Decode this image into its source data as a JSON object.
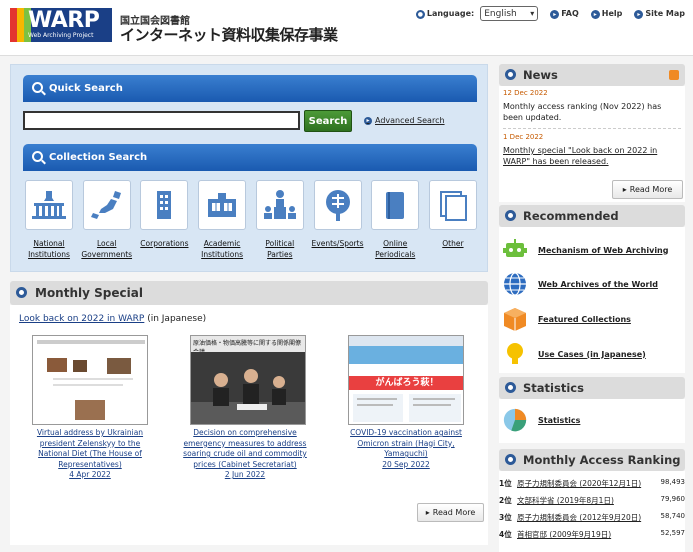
{
  "header": {
    "logo_text": "WARP",
    "logo_subtitle": "Web Archiving Project",
    "org_name": "国立国会図書館",
    "site_title": "インターネット資料収集保存事業",
    "language_label": "Language:",
    "language_value": "English",
    "faq_label": "FAQ",
    "help_label": "Help",
    "sitemap_label": "Site Map"
  },
  "quick_search": {
    "title": "Quick Search",
    "input_value": "",
    "button_label": "Search",
    "advanced_label": "Advanced Search"
  },
  "collection_search": {
    "title": "Collection Search",
    "items": [
      {
        "label": "National Institutions",
        "icon": "diet-building-icon"
      },
      {
        "label": "Local Governments",
        "icon": "japan-map-icon"
      },
      {
        "label": "Corporations",
        "icon": "office-building-icon"
      },
      {
        "label": "Academic Institutions",
        "icon": "school-icon"
      },
      {
        "label": "Political Parties",
        "icon": "politician-podium-icon"
      },
      {
        "label": "Events/Sports",
        "icon": "festival-fan-icon"
      },
      {
        "label": "Online Periodicals",
        "icon": "book-icon"
      },
      {
        "label": "Other",
        "icon": "documents-icon"
      }
    ]
  },
  "monthly_special": {
    "title": "Monthly Special",
    "intro_link": "Look back on 2022 in WARP",
    "intro_suffix": " (in Japanese)",
    "items": [
      {
        "caption": "Virtual address by Ukrainian president Zelenskyy to the National Diet (The House of Representatives)",
        "date": "4 Apr 2022"
      },
      {
        "caption": "Decision on comprehensive emergency measures to address soaring crude oil and commodity prices (Cabinet Secretariat)",
        "date": "2 Jun 2022"
      },
      {
        "caption": "COVID-19 vaccination against Omicron strain (Hagi City, Yamaguchi)",
        "date": "20 Sep 2022"
      }
    ],
    "thumb2_heading": "原油価格・物価高騰等に関する関係閣僚会議",
    "thumb3_banner": "がんばろう萩！",
    "read_more": "Read More"
  },
  "news": {
    "title": "News",
    "items": [
      {
        "date": "12 Dec 2022",
        "text": "Monthly access ranking (Nov 2022) has been updated."
      },
      {
        "date": "1 Dec 2022",
        "text": "Monthly special \"Look back on 2022 in WARP\" has been released."
      }
    ],
    "read_more": "Read More"
  },
  "recommended": {
    "title": "Recommended",
    "items": [
      {
        "label": "Mechanism of Web Archiving",
        "icon": "robot-icon"
      },
      {
        "label": "Web Archives of the World",
        "icon": "globe-icon"
      },
      {
        "label": "Featured Collections",
        "icon": "box-icon"
      },
      {
        "label": "Use Cases (in Japanese)",
        "icon": "lightbulb-icon"
      }
    ]
  },
  "statistics": {
    "title": "Statistics",
    "link": "Statistics"
  },
  "ranking": {
    "title": "Monthly Access Ranking",
    "rows": [
      {
        "rank": "1位",
        "title": "原子力規制委員会 (2020年12月1日)",
        "count": "98,493"
      },
      {
        "rank": "2位",
        "title": "文部科学省 (2019年8月1日)",
        "count": "79,960"
      },
      {
        "rank": "3位",
        "title": "原子力規制委員会 (2012年9月20日)",
        "count": "58,740"
      },
      {
        "rank": "4位",
        "title": "首相官邸 (2009年9月19日)",
        "count": "52,597"
      }
    ]
  },
  "colors": {
    "header_blue": "#2d5a98",
    "search_bar_blue": "#1a5ab0",
    "search_button_green": "#2e7120",
    "panel_bg": "#d8e6f4",
    "news_date": "#c65a00"
  }
}
